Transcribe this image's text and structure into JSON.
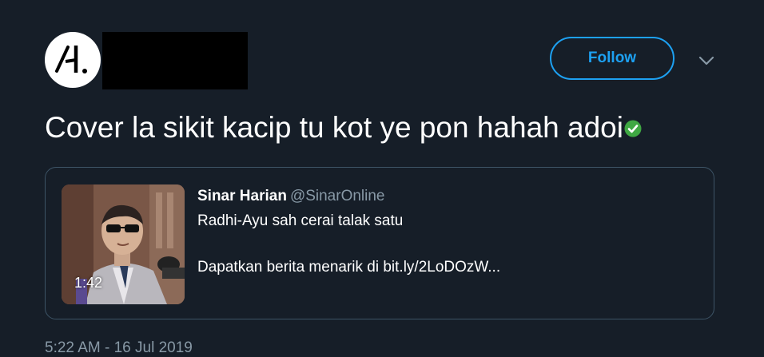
{
  "tweet": {
    "text": "Cover la sikit kacip tu kot ye pon hahah adoi",
    "emoji_icon": "check-mark-button-icon",
    "follow_label": "Follow",
    "timestamp": "5:22 AM - 16 Jul 2019"
  },
  "card": {
    "author_name": "Sinar Harian",
    "author_handle": "@SinarOnline",
    "title": "Radhi-Ayu sah cerai talak satu",
    "description": "Dapatkan berita menarik di bit.ly/2LoDOzW...",
    "video_duration": "1:42"
  },
  "colors": {
    "background": "#161e28",
    "accent": "#1da1f2",
    "muted": "#8899a6",
    "border": "#3d5466"
  }
}
